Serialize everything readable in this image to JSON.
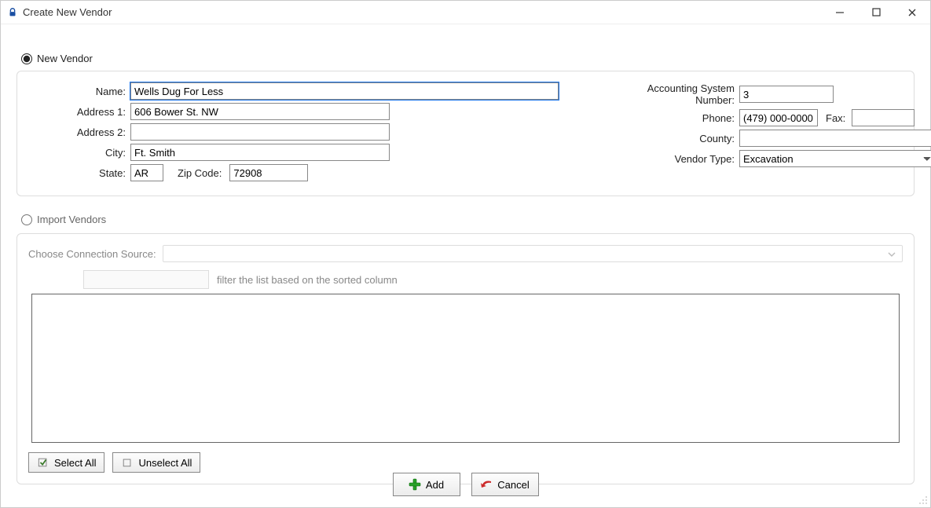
{
  "window": {
    "title": "Create New Vendor"
  },
  "mode": {
    "new_vendor_label": "New Vendor",
    "import_vendors_label": "Import Vendors",
    "selected": "new_vendor"
  },
  "labels": {
    "name": "Name:",
    "address1": "Address 1:",
    "address2": "Address 2:",
    "city": "City:",
    "state": "State:",
    "zip": "Zip Code:",
    "asn": "Accounting System Number:",
    "phone": "Phone:",
    "fax": "Fax:",
    "county": "County:",
    "vendor_type": "Vendor Type:",
    "connection_source": "Choose Connection Source:",
    "filter_hint": "filter the list based on the sorted column"
  },
  "form": {
    "name": "Wells Dug For Less",
    "address1": "606 Bower St. NW",
    "address2": "",
    "city": "Ft. Smith",
    "state": "AR",
    "zip": "72908",
    "asn": "3",
    "phone": "(479) 000-0000",
    "fax": "",
    "county": "",
    "vendor_type": "Excavation"
  },
  "vendor_type_options": [
    "Excavation"
  ],
  "buttons": {
    "select_all": "Select All",
    "unselect_all": "Unselect All",
    "add": "Add",
    "cancel": "Cancel"
  },
  "icons": {
    "lock": "lock-icon",
    "minimize": "minimize-icon",
    "maximize": "maximize-icon",
    "close": "close-icon",
    "check": "check-icon",
    "uncheck": "uncheck-icon",
    "plus": "plus-icon",
    "arrow": "cancel-arrow-icon"
  }
}
